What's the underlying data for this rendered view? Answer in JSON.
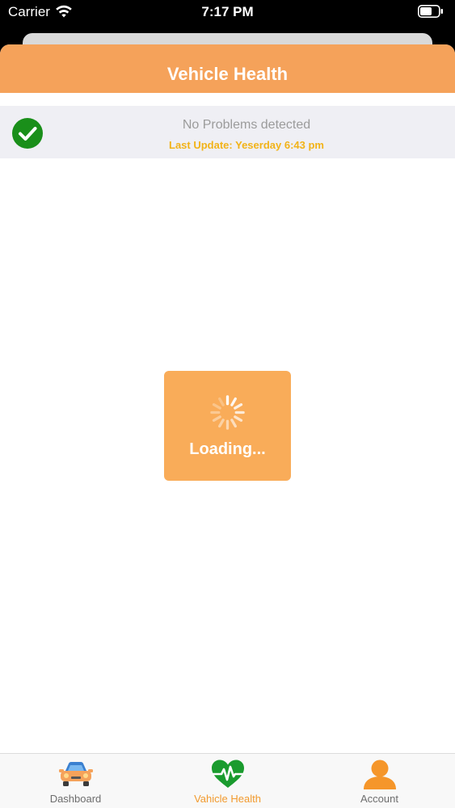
{
  "status_bar": {
    "carrier": "Carrier",
    "time": "7:17 PM"
  },
  "header": {
    "title": "Vehicle Health"
  },
  "health": {
    "status_text": "No Problems detected",
    "last_update": "Last Update: Yeserday 6:43 pm",
    "status_icon": "check-circle-icon"
  },
  "loading": {
    "text": "Loading...",
    "icon": "spinner-icon"
  },
  "tab_bar": {
    "selected": "Vahicle Health",
    "items": [
      {
        "label": "Dashboard",
        "icon": "car-icon"
      },
      {
        "label": "Vahicle Health",
        "icon": "heart-pulse-icon"
      },
      {
        "label": "Account",
        "icon": "user-icon"
      }
    ]
  },
  "colors": {
    "accent": "#f5a25a",
    "success": "#1a8f1a",
    "update_text": "#f2b318",
    "active_tab": "#f29a2e"
  }
}
